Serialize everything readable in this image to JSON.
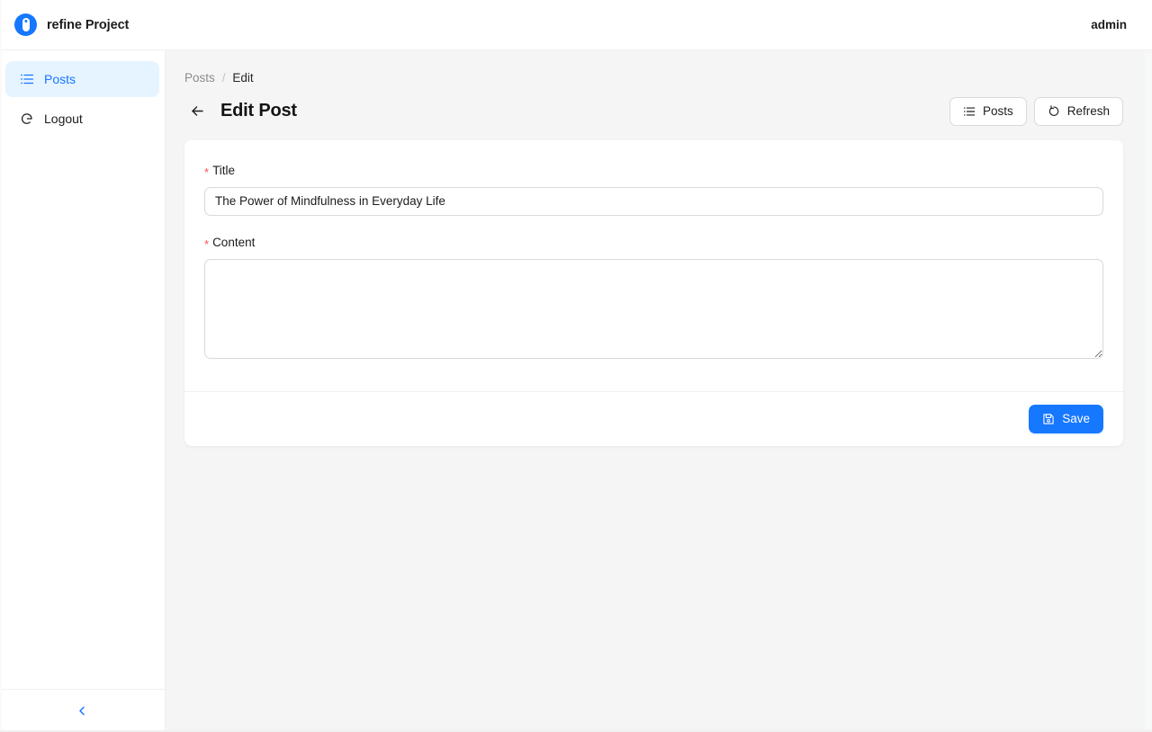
{
  "header": {
    "brand_name": "refine Project",
    "logo_icon": "refine-logo-icon",
    "user_name": "admin"
  },
  "sidebar": {
    "items": [
      {
        "label": "Posts",
        "icon": "list-icon",
        "active": true
      },
      {
        "label": "Logout",
        "icon": "logout-icon",
        "active": false
      }
    ],
    "collapse_icon": "chevron-left-icon"
  },
  "breadcrumb": {
    "items": [
      {
        "label": "Posts",
        "current": false
      },
      {
        "label": "Edit",
        "current": true
      }
    ],
    "separator": "/"
  },
  "page": {
    "title": "Edit Post",
    "back_icon": "arrow-left-icon"
  },
  "actions": {
    "posts_label": "Posts",
    "posts_icon": "list-icon",
    "refresh_label": "Refresh",
    "refresh_icon": "refresh-icon"
  },
  "form": {
    "title_field": {
      "label": "Title",
      "required_marker": "*",
      "value": "The Power of Mindfulness in Everyday Life",
      "placeholder": ""
    },
    "content_field": {
      "label": "Content",
      "required_marker": "*",
      "value": "",
      "placeholder": ""
    }
  },
  "footer": {
    "save_label": "Save",
    "save_icon": "save-icon"
  },
  "colors": {
    "accent": "#1677ff",
    "accent_bg": "#e6f4ff",
    "required": "#ff4d4f",
    "content_bg": "#f5f5f5",
    "border": "#d9d9d9"
  }
}
